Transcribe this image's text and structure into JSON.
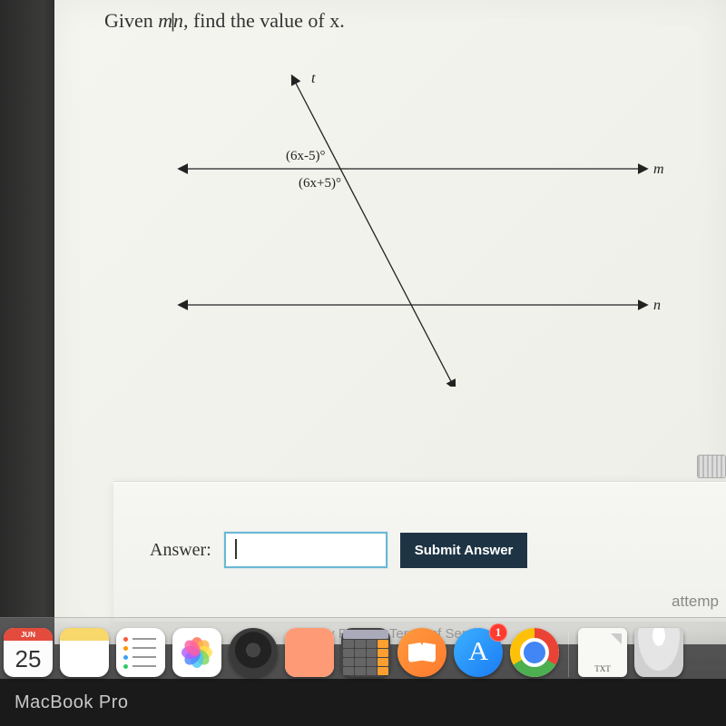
{
  "question": {
    "prefix": "Given ",
    "var1": "m",
    "parallel": "||",
    "var2": "n",
    "suffix": ", find the value of x."
  },
  "diagram": {
    "line_t": "t",
    "line_m": "m",
    "line_n": "n",
    "angle_top": "(6x-5)°",
    "angle_bottom": "(6x+5)°"
  },
  "answer_section": {
    "label": "Answer:",
    "input_value": "",
    "submit": "Submit Answer",
    "attempt": "attemp"
  },
  "footer": {
    "privacy": "Privacy Policy",
    "terms": "Terms of Service"
  },
  "dock": {
    "calendar_month": "JUN",
    "calendar_day": "25",
    "appstore_badge": "1",
    "page_ext": "TXT"
  },
  "device": "MacBook Pro"
}
